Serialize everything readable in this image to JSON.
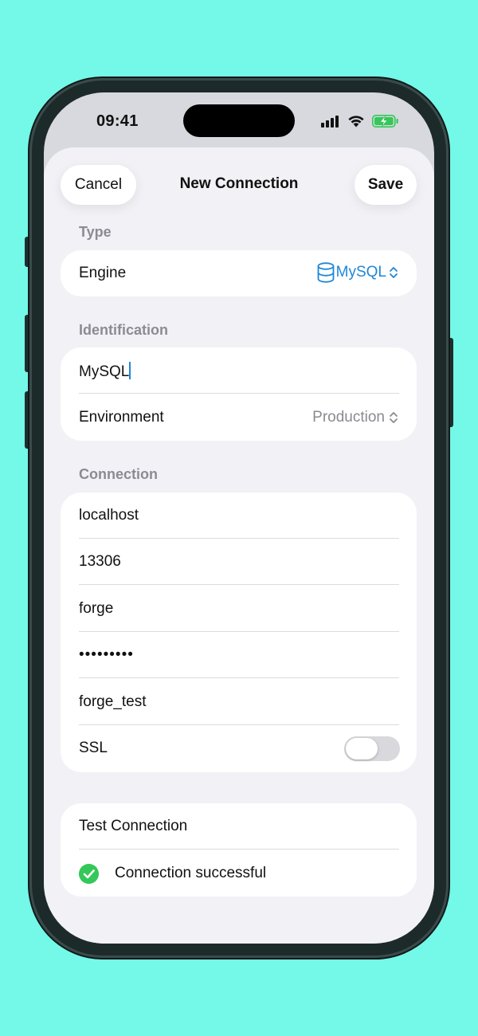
{
  "status_bar": {
    "time": "09:41"
  },
  "nav": {
    "cancel_label": "Cancel",
    "title": "New Connection",
    "save_label": "Save"
  },
  "type_section": {
    "header": "Type",
    "engine_label": "Engine",
    "engine_value": "MySQL",
    "engine_icon": "database-icon"
  },
  "identification_section": {
    "header": "Identification",
    "name_value": "MySQL",
    "environment_label": "Environment",
    "environment_value": "Production"
  },
  "connection_section": {
    "header": "Connection",
    "host_value": "localhost",
    "port_value": "13306",
    "user_value": "forge",
    "password_value": "•••••••••",
    "database_value": "forge_test",
    "ssl_label": "SSL",
    "ssl_enabled": false
  },
  "test_section": {
    "test_label": "Test Connection",
    "result_text": "Connection successful",
    "result_icon": "checkmark-circle-icon"
  },
  "colors": {
    "background": "#74f8e8",
    "accent": "#1f86d6",
    "success": "#34c759",
    "sheet": "#f1f1f6"
  }
}
